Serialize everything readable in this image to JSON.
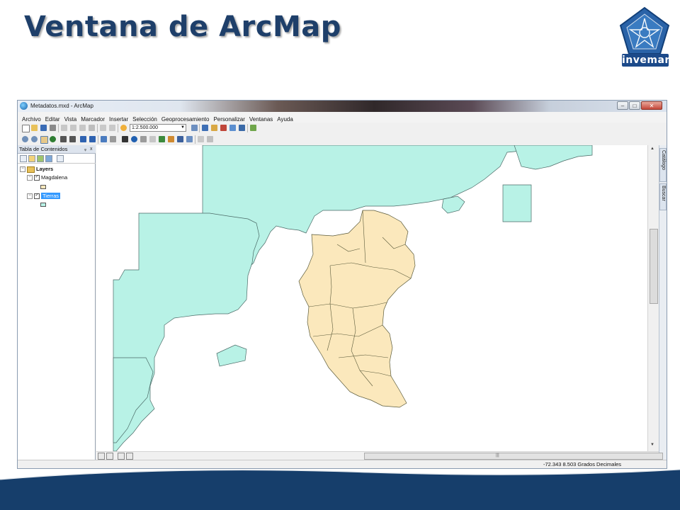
{
  "slide": {
    "title": "Ventana de ArcMap",
    "logo_text": "invemar"
  },
  "window": {
    "title": "Metadatos.mxd - ArcMap",
    "controls": {
      "minimize": "–",
      "maximize": "□",
      "close": "✕"
    }
  },
  "menu": [
    "Archivo",
    "Editar",
    "Vista",
    "Marcador",
    "Insertar",
    "Selección",
    "Geoprocesamiento",
    "Personalizar",
    "Ventanas",
    "Ayuda"
  ],
  "toolbar": {
    "scale_value": "1:2.500.000"
  },
  "toc": {
    "title": "Tabla de Contenidos",
    "pin": "ᵩ",
    "close": "x",
    "root_label": "Layers",
    "layers": [
      {
        "name": "Magdalena",
        "checked": true,
        "selected": false,
        "fill": "#fbe8bc"
      },
      {
        "name": "Tierras",
        "checked": true,
        "selected": true,
        "fill": "#b8f2e6"
      }
    ]
  },
  "side_tabs": [
    "Catálogo",
    "Buscar"
  ],
  "status": {
    "coordinates": "-72.343  8.503 Grados Decimales"
  },
  "colors": {
    "title_color": "#1e3f6a",
    "band_color": "#163e6b",
    "tierras_fill": "#b8f2e6",
    "magdalena_fill": "#fbe8bc",
    "selection_blue": "#3399ff"
  }
}
